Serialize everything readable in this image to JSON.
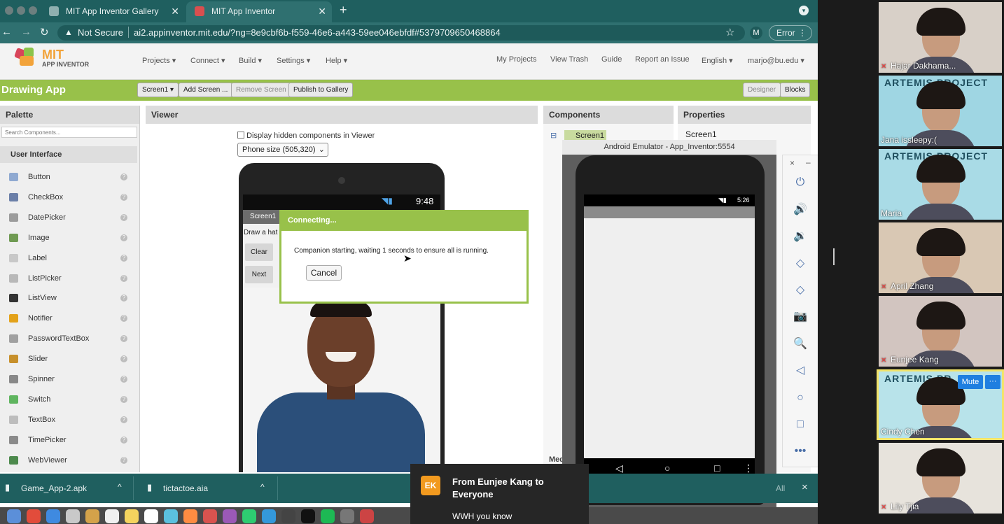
{
  "browser": {
    "tabs": [
      {
        "label": "MIT App Inventor Gallery",
        "active": false
      },
      {
        "label": "MIT App Inventor",
        "active": true
      }
    ],
    "security_label": "Not Secure",
    "url": "ai2.appinventor.mit.edu/?ng=8e9cbf6b-f559-46e6-a443-59ee046ebfdf#5379709650468864",
    "profile_initial": "M",
    "error_label": "Error"
  },
  "app": {
    "logo_text_top": "MIT",
    "logo_text_bottom": "APP INVENTOR",
    "nav": [
      "Projects ▾",
      "Connect ▾",
      "Build ▾",
      "Settings ▾",
      "Help ▾"
    ],
    "right_nav": [
      "My Projects",
      "View Trash",
      "Guide",
      "Report an Issue",
      "English ▾",
      "marjo@bu.edu ▾"
    ],
    "project_name": "Drawing App",
    "screen_select": "Screen1 ▾",
    "add_screen": "Add Screen ...",
    "remove_screen": "Remove Screen",
    "publish": "Publish to Gallery",
    "designer": "Designer",
    "blocks": "Blocks"
  },
  "palette": {
    "title": "Palette",
    "search_placeholder": "Search Components...",
    "section": "User Interface",
    "items": [
      {
        "label": "Button",
        "color": "#8fa9d1"
      },
      {
        "label": "CheckBox",
        "color": "#6b7fa8"
      },
      {
        "label": "DatePicker",
        "color": "#9b9b9b"
      },
      {
        "label": "Image",
        "color": "#6f9a52"
      },
      {
        "label": "Label",
        "color": "#c8c8c8"
      },
      {
        "label": "ListPicker",
        "color": "#b8b8b8"
      },
      {
        "label": "ListView",
        "color": "#333333"
      },
      {
        "label": "Notifier",
        "color": "#e3a21a"
      },
      {
        "label": "PasswordTextBox",
        "color": "#a0a0a0"
      },
      {
        "label": "Slider",
        "color": "#c7902b"
      },
      {
        "label": "Spinner",
        "color": "#888888"
      },
      {
        "label": "Switch",
        "color": "#5fb55f"
      },
      {
        "label": "TextBox",
        "color": "#bdbdbd"
      },
      {
        "label": "TimePicker",
        "color": "#8a8a8a"
      },
      {
        "label": "WebViewer",
        "color": "#4d8a4d"
      }
    ],
    "help_glyph": "?"
  },
  "viewer": {
    "title": "Viewer",
    "hidden_components_label": "Display hidden components in Viewer",
    "phone_size": "Phone size (505,320)",
    "phone_time": "9:48",
    "screen_title": "Screen1",
    "canvas_text": "Draw a hat",
    "clear_button": "Clear",
    "next_button": "Next"
  },
  "dialog": {
    "title": "Connecting...",
    "message": "Companion starting, waiting 1 seconds to ensure all is running.",
    "cancel": "Cancel"
  },
  "components": {
    "title": "Components",
    "collapse_glyph": "⊟",
    "root": "Screen1",
    "footer_partial": "Med"
  },
  "properties": {
    "title": "Properties",
    "screen": "Screen1"
  },
  "emulator": {
    "title": "Android Emulator - App_Inventor:5554",
    "time": "5:26",
    "nav_back": "◁",
    "nav_home": "○",
    "nav_recent": "□",
    "nav_more": "⋮",
    "toolbar_close": "×",
    "toolbar_min": "–",
    "tools": [
      "⏻",
      "🔊",
      "🔉",
      "◇",
      "◇",
      "📷",
      "🔍",
      "◁",
      "○",
      "□",
      "•••"
    ]
  },
  "downloads": {
    "files": [
      "Game_App-2.apk",
      "tictactoe.aia"
    ],
    "show_all_partial": "All",
    "caret": "^",
    "close": "×"
  },
  "chat": {
    "avatar_initials": "EK",
    "from": "From Eunjee Kang to Everyone",
    "message": "WWH you know",
    "avatar_color": "#f29a1f"
  },
  "participants": [
    {
      "name": "Hajar Dakhama...",
      "muted": true,
      "bg": "#d8d0c8"
    },
    {
      "name": "Jana issleepy:(",
      "muted": false,
      "bg": "#9fd6e3",
      "banner": "ARTEMIS PROJECT"
    },
    {
      "name": "Maria",
      "muted": false,
      "bg": "#a9dbe6",
      "banner": "ARTEMIS PROJECT"
    },
    {
      "name": "April Zhang",
      "muted": true,
      "bg": "#d9c8b4"
    },
    {
      "name": "Eunjee Kang",
      "muted": true,
      "bg": "#d2c5c0"
    },
    {
      "name": "Cindy Chen",
      "muted": false,
      "bg": "#b8e3ea",
      "banner": "ARTEMIS PR",
      "mute_button": "Mute",
      "more": "···",
      "highlight": "#f2e46a"
    },
    {
      "name": "Lily Tjia",
      "muted": true,
      "bg": "#e7e3dc"
    }
  ]
}
